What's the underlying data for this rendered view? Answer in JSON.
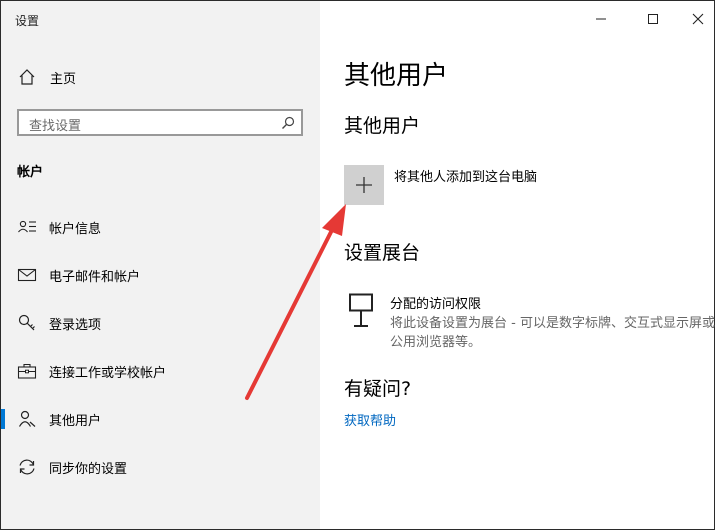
{
  "window": {
    "title": "设置"
  },
  "sidebar": {
    "home_label": "主页",
    "search_placeholder": "查找设置",
    "section_title": "帐户",
    "items": [
      {
        "label": "帐户信息",
        "icon": "account-info-icon"
      },
      {
        "label": "电子邮件和帐户",
        "icon": "mail-icon"
      },
      {
        "label": "登录选项",
        "icon": "key-icon"
      },
      {
        "label": "连接工作或学校帐户",
        "icon": "briefcase-icon"
      },
      {
        "label": "其他用户",
        "icon": "person-icon",
        "active": true
      },
      {
        "label": "同步你的设置",
        "icon": "sync-icon"
      }
    ],
    "active_color": "#0078d4"
  },
  "main": {
    "page_title": "其他用户",
    "other_users": {
      "heading": "其他用户",
      "add_label": "将其他人添加到这台电脑"
    },
    "kiosk": {
      "heading": "设置展台",
      "item_title": "分配的访问权限",
      "item_desc": "将此设备设置为展台 - 可以是数字标牌、交互式显示屏或公用浏览器等。"
    },
    "help": {
      "heading": "有疑问?",
      "link": "获取帮助"
    }
  },
  "annotation": {
    "type": "red-arrow",
    "color": "#e53935",
    "points_to": "add-user-button"
  }
}
